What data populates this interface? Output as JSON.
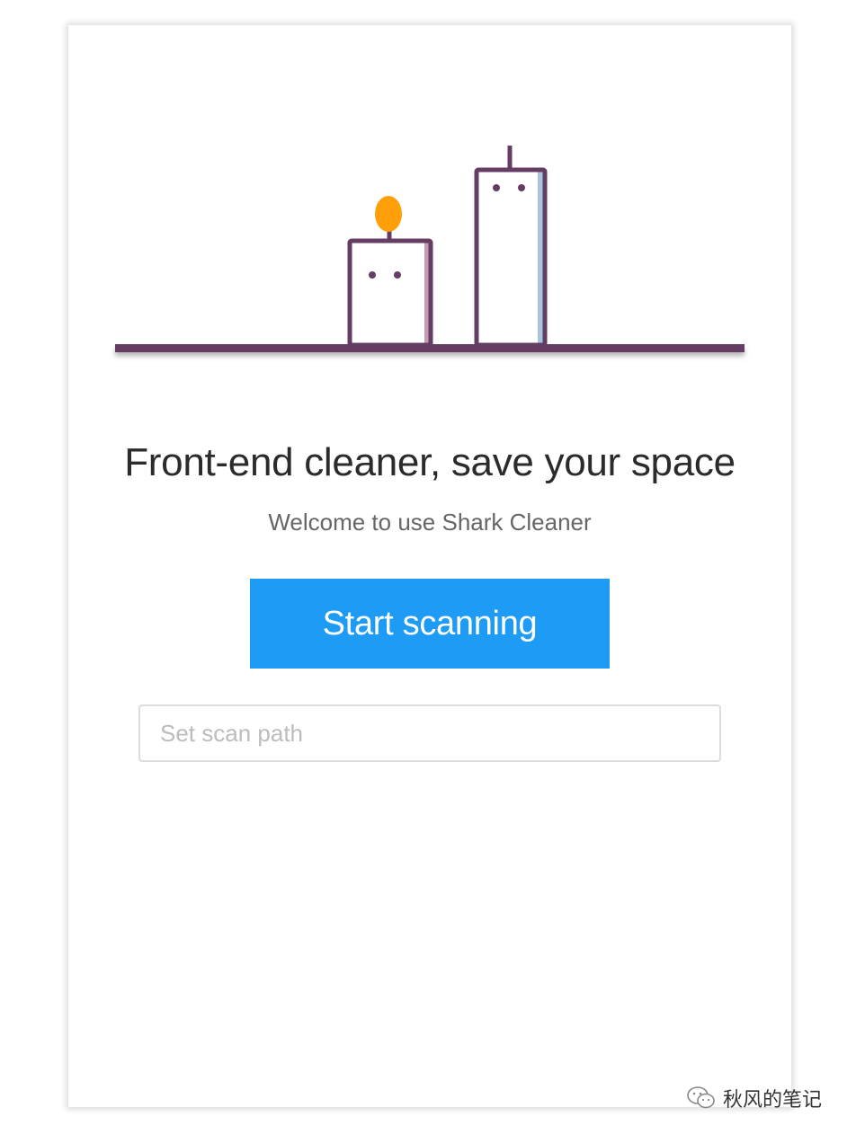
{
  "header": {
    "title": "Front-end cleaner, save your space",
    "subtitle": "Welcome to use Shark Cleaner"
  },
  "actions": {
    "start_label": "Start scanning"
  },
  "scan_path": {
    "value": "",
    "placeholder": "Set scan path"
  },
  "illustration": {
    "icon": "candles-illustration",
    "colors": {
      "outline": "#643c64",
      "flame": "#ff9f0a",
      "shade_left": "#c39bb4",
      "shade_right": "#a8c4e0"
    }
  },
  "watermark": {
    "text": "秋风的笔记",
    "icon": "wechat-icon"
  },
  "colors": {
    "primary": "#1e9bf5",
    "heading": "#2b2b2b",
    "muted": "#666666"
  }
}
